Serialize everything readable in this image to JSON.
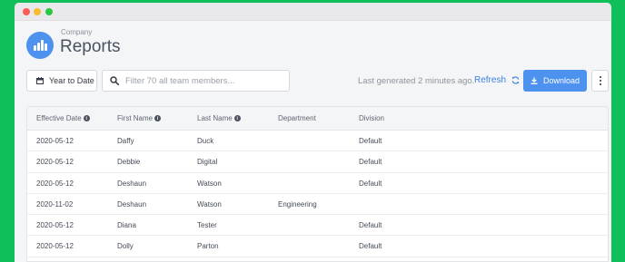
{
  "header": {
    "company": "Company",
    "title": "Reports"
  },
  "toolbar": {
    "date_range_label": "Year to Date",
    "search_placeholder": "Filter 70 all team members...",
    "search_value": "",
    "generated_text": "Last generated 2 minutes ago.",
    "refresh_label": "Refresh",
    "download_label": "Download"
  },
  "table": {
    "columns": [
      "Effective Date",
      "First Name",
      "Last Name",
      "Department",
      "Division"
    ],
    "rows": [
      [
        "2020-05-12",
        "Daffy",
        "Duck",
        "",
        "Default"
      ],
      [
        "2020-05-12",
        "Debbie",
        "Digital",
        "",
        "Default"
      ],
      [
        "2020-05-12",
        "Deshaun",
        "Watson",
        "",
        "Default"
      ],
      [
        "2020-11-02",
        "Deshaun",
        "Watson",
        "Engineering",
        ""
      ],
      [
        "2020-05-12",
        "Diana",
        "Tester",
        "",
        "Default"
      ],
      [
        "2020-05-12",
        "Dolly",
        "Parton",
        "",
        "Default"
      ]
    ]
  },
  "colors": {
    "background": "#0fbf5a",
    "accent": "#4d92ee",
    "link": "#3b82e0"
  },
  "icons": {
    "logo": "bar-chart-icon",
    "date": "calendar-icon",
    "search": "search-icon",
    "refresh": "refresh-icon",
    "download": "download-icon",
    "more": "more-vertical-icon",
    "info": "info-icon"
  }
}
